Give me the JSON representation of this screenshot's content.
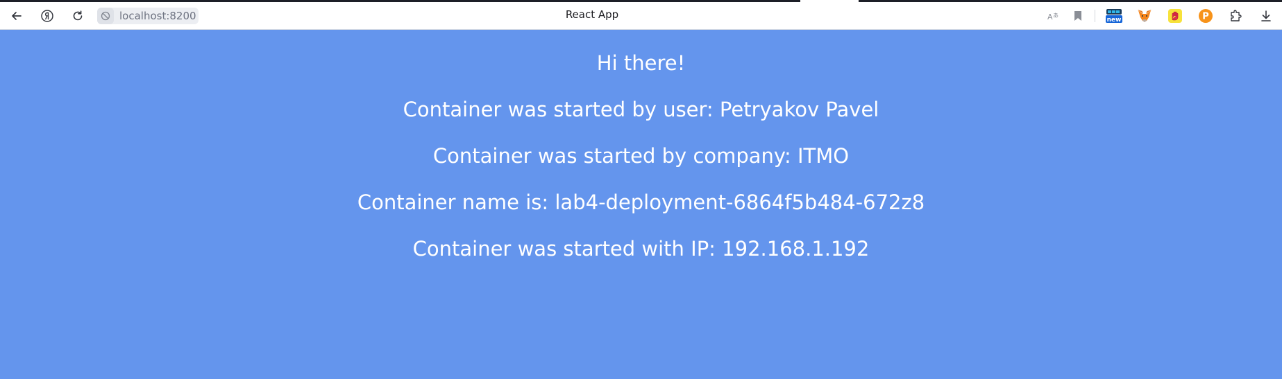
{
  "browser": {
    "url": "localhost:8200",
    "tab_title": "React App",
    "extension_badge_new": "new",
    "icons": {
      "back": "back-arrow-icon",
      "yandex": "yandex-logo-icon",
      "reload": "reload-icon",
      "site_info": "site-info-icon",
      "translate": "translate-icon",
      "bookmark": "bookmark-icon",
      "ext_new": "extension-new-icon",
      "ext_fox": "metamask-fox-icon",
      "ext_hand": "hand-extension-icon",
      "ext_p": "p-coin-extension-icon",
      "ext_puzzle": "extensions-icon",
      "download": "download-icon"
    }
  },
  "page": {
    "background": "#6495ed",
    "text_color": "#ffffff",
    "greeting": "Hi there!",
    "user_line": "Container was started by user: Petryakov Pavel",
    "company_line": "Container was started by company: ITMO",
    "name_line": "Container name is: lab4-deployment-6864f5b484-672z8",
    "ip_line": "Container was started with IP: 192.168.1.192"
  }
}
